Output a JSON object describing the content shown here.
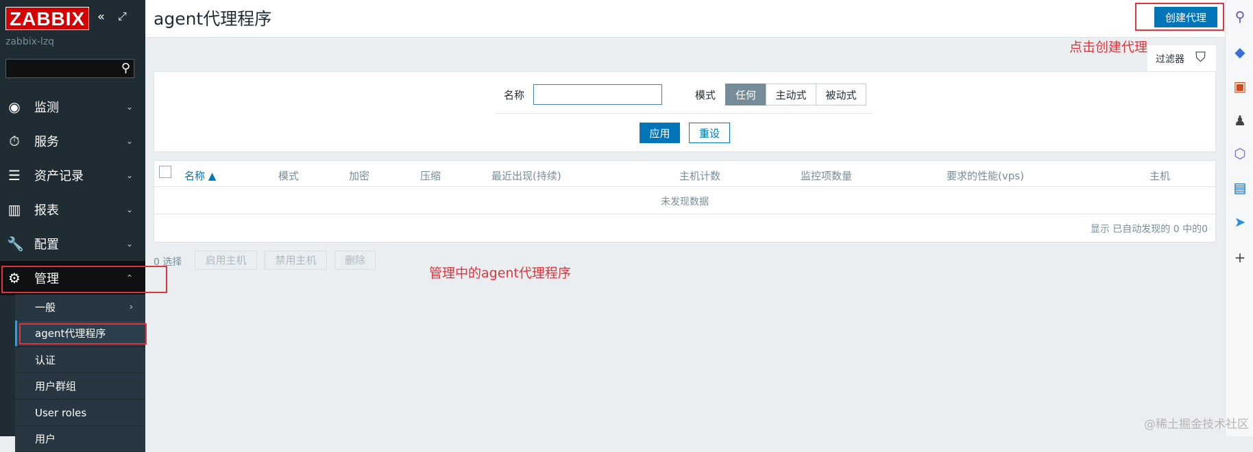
{
  "sidebar": {
    "logo": "ZABBIX",
    "host": "zabbix-lzq",
    "search_placeholder": "",
    "menu": [
      {
        "label": "监测",
        "icon": "eye-icon"
      },
      {
        "label": "服务",
        "icon": "timer-icon"
      },
      {
        "label": "资产记录",
        "icon": "list-icon"
      },
      {
        "label": "报表",
        "icon": "chart-icon"
      },
      {
        "label": "配置",
        "icon": "wrench-icon"
      },
      {
        "label": "管理",
        "icon": "gear-icon"
      }
    ],
    "submenu": [
      "一般",
      "agent代理程序",
      "认证",
      "用户群组",
      "User roles",
      "用户"
    ]
  },
  "header": {
    "title": "agent代理程序",
    "create_button": "创建代理"
  },
  "filter": {
    "tab_label": "过滤器",
    "name_label": "名称",
    "name_value": "",
    "mode_label": "模式",
    "mode_options": [
      "任何",
      "主动式",
      "被动式"
    ],
    "mode_selected": "任何",
    "apply_label": "应用",
    "reset_label": "重设"
  },
  "table": {
    "columns": [
      "名称 ▲",
      "模式",
      "加密",
      "压缩",
      "最近出现(持续)",
      "主机计数",
      "监控项数量",
      "要求的性能(vps)",
      "主机"
    ],
    "empty_text": "未发现数据",
    "summary": "显示 已自动发现的 0 中的0"
  },
  "actions": {
    "selected": "0 选择",
    "enable_hosts": "启用主机",
    "disable_hosts": "禁用主机",
    "delete": "删除"
  },
  "annotations": {
    "create_hint": "点击创建代理",
    "admin_hint": "管理中的agent代理程序"
  },
  "watermark": "@稀土掘金技术社区",
  "colors": {
    "sidebar_bg": "#1f2c33",
    "accent": "#0275b8",
    "logo_red": "#d40000",
    "annotation_red": "#e0333a"
  }
}
